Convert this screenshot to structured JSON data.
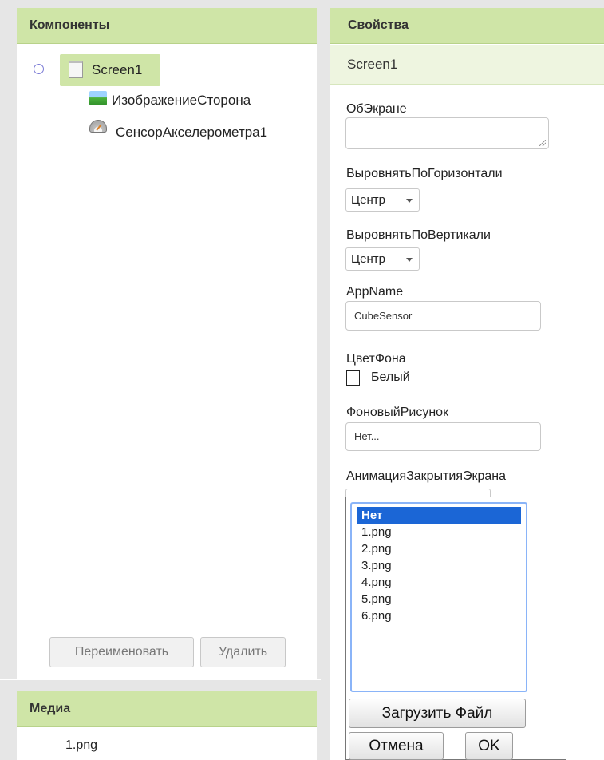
{
  "components_panel": {
    "header": "Компоненты",
    "tree": {
      "root_label": "Screen1",
      "children": [
        "ИзображениеСторона",
        "СенсорАкселерометра1"
      ]
    },
    "rename_button": "Переименовать",
    "delete_button": "Удалить"
  },
  "media_panel": {
    "header": "Медиа",
    "items": [
      "1.png"
    ]
  },
  "properties_panel": {
    "header": "Свойства",
    "component_name": "Screen1",
    "about_screen": {
      "label": "ОбЭкране",
      "value": ""
    },
    "align_horizontal": {
      "label": "ВыровнятьПоГоризонтали",
      "value": "Центр"
    },
    "align_vertical": {
      "label": "ВыровнятьПоВертикали",
      "value": "Центр"
    },
    "app_name": {
      "label": "AppName",
      "value": "CubeSensor"
    },
    "background_color": {
      "label": "ЦветФона",
      "value": "Белый"
    },
    "background_image": {
      "label": "ФоновыйРисунок",
      "value": "Нет..."
    },
    "close_screen_animation": {
      "label": "АнимацияЗакрытияЭкрана"
    }
  },
  "asset_picker": {
    "options": [
      "Нет",
      "1.png",
      "2.png",
      "3.png",
      "4.png",
      "5.png",
      "6.png"
    ],
    "selected": "Нет",
    "upload_button": "Загрузить Файл",
    "cancel_button": "Отмена",
    "ok_button": "OK"
  },
  "colors": {
    "header_green": "#cfe5a7",
    "subheader_green": "#eef5e0",
    "selection_blue": "#1b66d6",
    "focus_blue": "#8ab4f8"
  }
}
